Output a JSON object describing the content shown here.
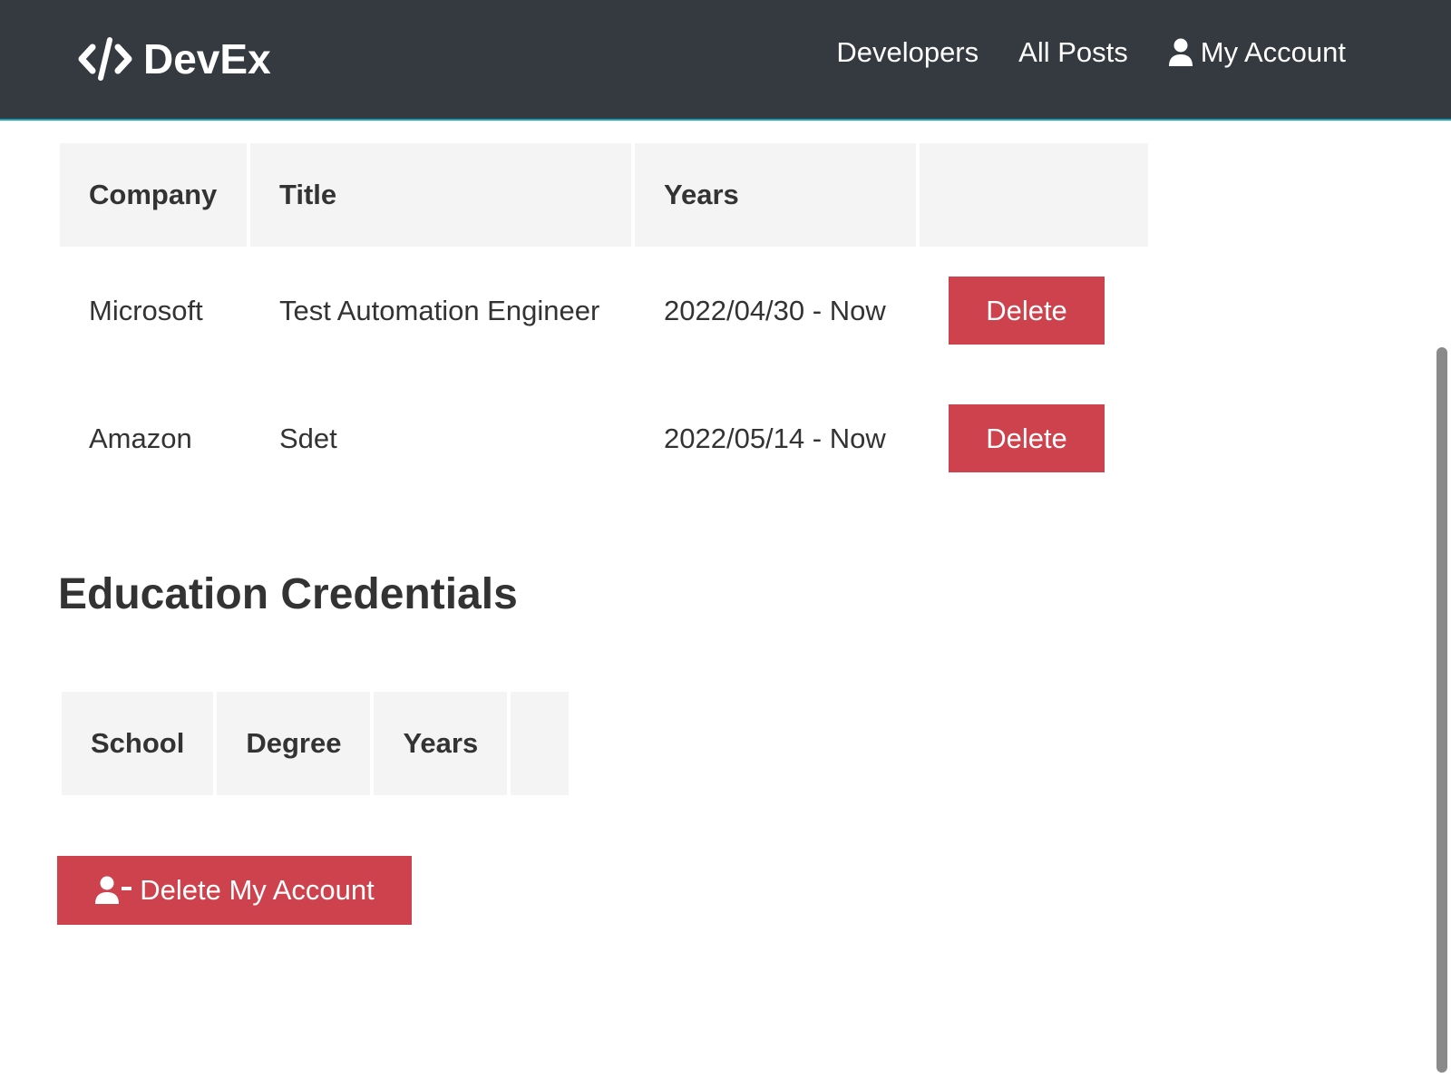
{
  "navbar": {
    "brand": "DevEx",
    "links": {
      "developers": "Developers",
      "posts": "All Posts",
      "account": "My Account"
    }
  },
  "experience": {
    "headers": {
      "company": "Company",
      "title": "Title",
      "years": "Years",
      "action": ""
    },
    "rows": [
      {
        "company": "Microsoft",
        "title": "Test Automation Engineer",
        "years": "2022/04/30 - Now",
        "delete_label": "Delete"
      },
      {
        "company": "Amazon",
        "title": "Sdet",
        "years": "2022/05/14 - Now",
        "delete_label": "Delete"
      }
    ]
  },
  "education": {
    "title": "Education Credentials",
    "headers": {
      "school": "School",
      "degree": "Degree",
      "years": "Years",
      "action": ""
    }
  },
  "delete_account_label": "Delete My Account",
  "colors": {
    "navbar_bg": "#343a40",
    "navbar_border": "#17a2b8",
    "danger": "#cd424c",
    "header_cell_bg": "#f4f4f4"
  }
}
